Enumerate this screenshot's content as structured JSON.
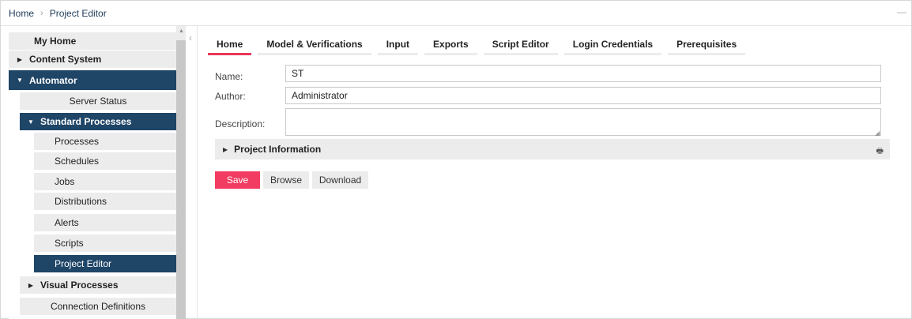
{
  "breadcrumb": {
    "items": [
      "Home",
      "Project Editor"
    ],
    "separator": "›"
  },
  "sidebar": {
    "my_home": "My Home",
    "content_system": "Content System",
    "automator": "Automator",
    "server_status": "Server Status",
    "standard_processes": "Standard Processes",
    "processes": "Processes",
    "schedules": "Schedules",
    "jobs": "Jobs",
    "distributions": "Distributions",
    "alerts": "Alerts",
    "scripts": "Scripts",
    "project_editor": "Project Editor",
    "visual_processes": "Visual Processes",
    "connection_definitions": "Connection Definitions"
  },
  "tabs": [
    {
      "label": "Home",
      "active": true
    },
    {
      "label": "Model & Verifications",
      "active": false
    },
    {
      "label": "Input",
      "active": false
    },
    {
      "label": "Exports",
      "active": false
    },
    {
      "label": "Script Editor",
      "active": false
    },
    {
      "label": "Login Credentials",
      "active": false
    },
    {
      "label": "Prerequisites",
      "active": false
    }
  ],
  "form": {
    "name_label": "Name:",
    "name_value": "ST",
    "author_label": "Author:",
    "author_value": "Administrator",
    "description_label": "Description:",
    "description_value": ""
  },
  "section": {
    "title": "Project Information"
  },
  "buttons": {
    "save": "Save",
    "browse": "Browse",
    "download": "Download"
  },
  "colors": {
    "accent": "#f23c62",
    "nav_active": "#1f4567",
    "panel_gray": "#ececec"
  },
  "icons": {
    "collapse": "chevron-left-icon",
    "print": "print-icon",
    "minimize": "minimize-icon"
  }
}
